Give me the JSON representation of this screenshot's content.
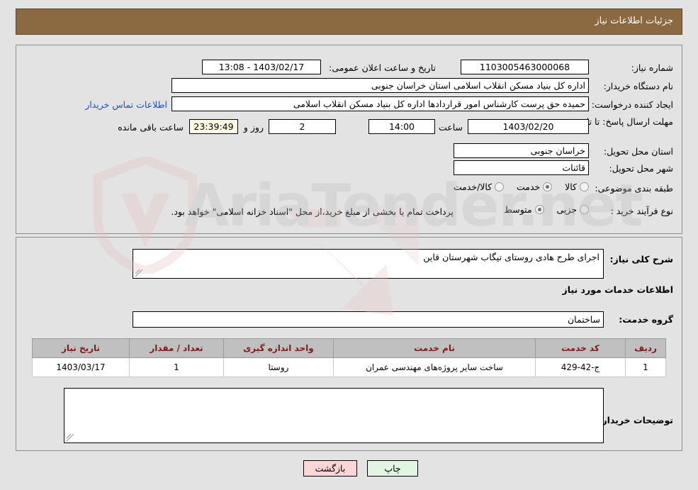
{
  "header": {
    "title": "جزئیات اطلاعات نیاز"
  },
  "fields": {
    "need_number_label": "شماره نیاز:",
    "need_number_value": "1103005463000068",
    "announce_label": "تاریخ و ساعت اعلان عمومی:",
    "announce_value": "13:08 - 1403/02/17",
    "buyer_org_label": "نام دستگاه خریدار:",
    "buyer_org_value": "اداره کل بنیاد مسکن انقلاب اسلامی استان خراسان جنوبی",
    "creator_label": "ایجاد کننده درخواست:",
    "creator_value": "حمیده حق پرست کارشناس امور قراردادها اداره کل بنیاد مسکن انقلاب اسلامی",
    "contact_link": "اطلاعات تماس خریدار",
    "deadline_label": "مهلت ارسال پاسخ: تا تاریخ:",
    "deadline_date": "1403/02/20",
    "hour_label": "ساعت",
    "deadline_time": "14:00",
    "days_remaining": "2",
    "days_label": "روز و",
    "time_remaining": "23:39:49",
    "remaining_suffix": "ساعت باقی مانده",
    "province_label": "استان محل تحویل:",
    "province_value": "خراسان جنوبی",
    "city_label": "شهر محل تحویل:",
    "city_value": "قائنات",
    "category_label": "طبقه بندی موضوعی:",
    "process_label": "نوع فرآیند خرید :",
    "treasury_note": "پرداخت تمام یا بخشی از مبلغ خرید،از محل \"اسناد خزانه اسلامی\" خواهد بود."
  },
  "category_options": [
    {
      "label": "کالا",
      "selected": false
    },
    {
      "label": "خدمت",
      "selected": true
    },
    {
      "label": "کالا/خدمت",
      "selected": false
    }
  ],
  "process_options": [
    {
      "label": "جزیی",
      "selected": false
    },
    {
      "label": "متوسط",
      "selected": true
    }
  ],
  "details": {
    "summary_label": "شرح کلی نیاز:",
    "summary_value": "اجرای طرح هادی روستای تیگاب شهرستان قاین",
    "services_heading": "اطلاعات خدمات مورد نیاز",
    "service_group_label": "گروه خدمت:",
    "service_group_value": "ساختمان",
    "buyer_notes_label": "توضیحات خریدار;",
    "buyer_notes_value": ""
  },
  "services_table": {
    "columns": [
      "ردیف",
      "کد خدمت",
      "نام خدمت",
      "واحد اندازه گیری",
      "تعداد / مقدار",
      "تاریخ نیاز"
    ],
    "rows": [
      {
        "row_no": "1",
        "service_code": "ج-42-429",
        "service_name": "ساخت سایر پروژه‌های مهندسی عمران",
        "unit": "روستا",
        "quantity": "1",
        "need_date": "1403/03/17"
      }
    ]
  },
  "footer": {
    "print_label": "چاپ",
    "back_label": "بازگشت"
  },
  "watermark": {
    "text": "AriaTender.net"
  },
  "colors": {
    "header_bg": "#8b6a42",
    "page_bg": "#e3e3e3",
    "link": "#1a50c8",
    "table_header_text": "#7b1b1b",
    "print_btn_bg": "#e2f4e2",
    "back_btn_bg": "#fbd6d6",
    "highlight_field": "#fbfbe4"
  }
}
